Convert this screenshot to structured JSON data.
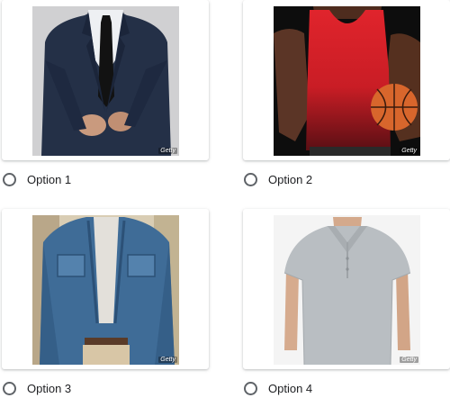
{
  "options": [
    {
      "label": "Option 1",
      "watermark": "Getty",
      "image": "man-in-navy-suit-and-tie"
    },
    {
      "label": "Option 2",
      "watermark": "Getty",
      "image": "man-in-red-tank-top-holding-basketball"
    },
    {
      "label": "Option 3",
      "watermark": "Getty",
      "image": "man-in-denim-jacket"
    },
    {
      "label": "Option 4",
      "watermark": "Getty",
      "image": "man-in-grey-polo-shirt"
    }
  ],
  "colors": {
    "radio_border": "#5f6368",
    "label_text": "#202124",
    "card_bg": "#ffffff"
  }
}
